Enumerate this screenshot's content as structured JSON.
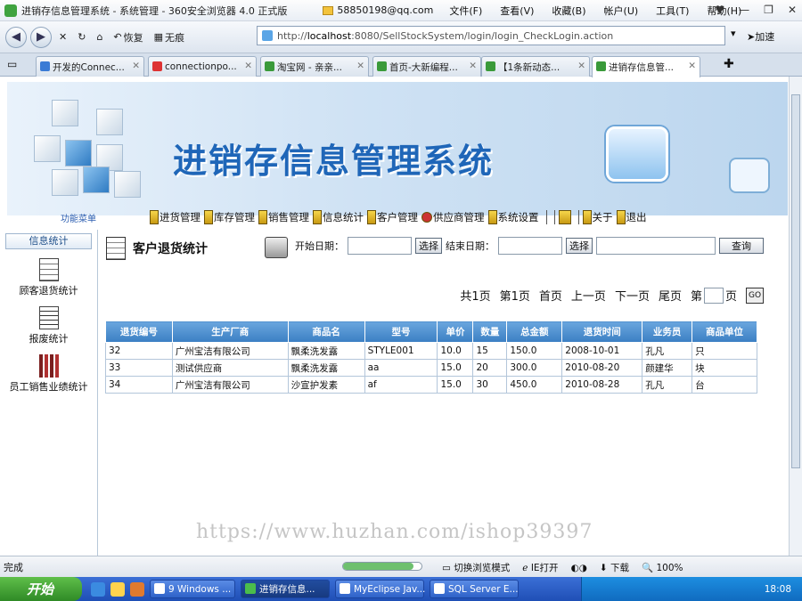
{
  "window": {
    "title": "进销存信息管理系统 - 系统管理 - 360安全浏览器 4.0 正式版",
    "email": "58850198@qq.com",
    "menu": [
      "文件(F)",
      "查看(V)",
      "收藏(B)",
      "帐户(U)",
      "工具(T)",
      "帮助(H)"
    ]
  },
  "toolbar": {
    "restore": "恢复",
    "noshadow": "无痕",
    "url_prefix": "http://",
    "url_host": "localhost",
    "url_rest": ":8080/SellStockSystem/login/login_CheckLogin.action",
    "speedup": "加速"
  },
  "tabs": [
    "开发的Connec...",
    "connectionpo...",
    "淘宝网 - 亲亲...",
    "首页-大新编程...",
    "【1条新动态...",
    "进销存信息管..."
  ],
  "banner": {
    "title": "进销存信息管理系统"
  },
  "nav": {
    "menu_label": "功能菜单",
    "items": [
      "进货管理",
      "库存管理",
      "销售管理",
      "信息统计",
      "客户管理",
      "供应商管理",
      "系统设置"
    ],
    "about": "关于",
    "exit": "退出"
  },
  "sidebar": {
    "header": "信息统计",
    "items": [
      "顾客退货统计",
      "报废统计",
      "员工销售业绩统计"
    ]
  },
  "page": {
    "title": "客户退货统计",
    "start_label": "开始日期：",
    "end_label": "结束日期：",
    "choose": "选择",
    "query": "查询"
  },
  "pager": {
    "total": "共1页",
    "current": "第1页",
    "first": "首页",
    "prev": "上一页",
    "next": "下一页",
    "last": "尾页",
    "goto_prefix": "第",
    "goto_suffix": "页",
    "go": "GO"
  },
  "table": {
    "headers": [
      "退货编号",
      "生产厂商",
      "商品名",
      "型号",
      "单价",
      "数量",
      "总金额",
      "退货时间",
      "业务员",
      "商品单位"
    ],
    "rows": [
      [
        "32",
        "广州宝洁有限公司",
        "飘柔洗发露",
        "STYLE001",
        "10.0",
        "15",
        "150.0",
        "2008-10-01",
        "孔凡",
        "只"
      ],
      [
        "33",
        "测试供应商",
        "飘柔洗发露",
        "aa",
        "15.0",
        "20",
        "300.0",
        "2010-08-20",
        "颜建华",
        "块"
      ],
      [
        "34",
        "广州宝洁有限公司",
        "沙宣护发素",
        "af",
        "15.0",
        "30",
        "450.0",
        "2010-08-28",
        "孔凡",
        "台"
      ]
    ]
  },
  "status": {
    "text": "完成",
    "mode": "切换浏览模式",
    "ie": "IE打开",
    "download": "下载",
    "zoom": "100%",
    "progress": 0.9
  },
  "taskbar": {
    "start": "开始",
    "tasks": [
      "9 Windows ...",
      "进销存信息...",
      "MyEclipse Jav...",
      "SQL Server E..."
    ],
    "clock": "18:08"
  },
  "watermark": "https://www.huzhan.com/ishop39397"
}
